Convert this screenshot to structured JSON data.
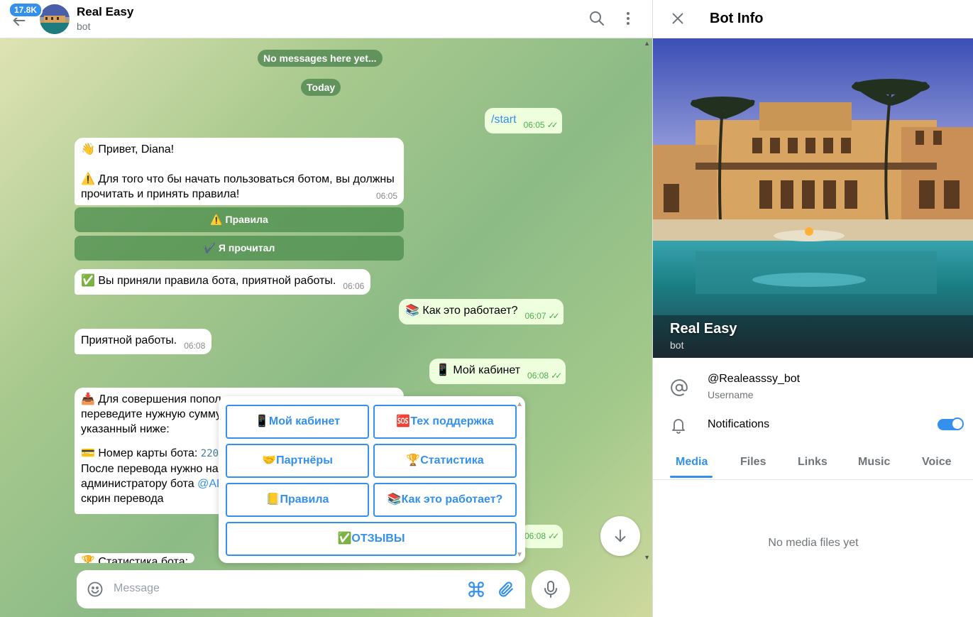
{
  "chat_header": {
    "unread_badge": "17.8K",
    "title": "Real Easy",
    "subtitle": "bot"
  },
  "service": {
    "empty": "No messages here yet...",
    "date": "Today"
  },
  "messages": [
    {
      "dir": "out",
      "text": "/start",
      "time": "06:05"
    },
    {
      "dir": "in",
      "line1": "👋 Привет, Diana!",
      "line2": "⚠️ Для того что бы начать пользоваться ботом, вы должны прочитать и принять правила!",
      "time": "06:05"
    },
    {
      "dir": "in",
      "text": "✅ Вы приняли правила бота, приятной работы.",
      "time": "06:06"
    },
    {
      "dir": "out",
      "text": "📚 Как это работает?",
      "time": "06:07"
    },
    {
      "dir": "in",
      "text": "Приятной работы.",
      "time": "06:08"
    },
    {
      "dir": "out",
      "text": "📱 Мой кабинет",
      "time": "06:08"
    },
    {
      "dir": "in",
      "line1": "📥 Для совершения попол",
      "line2": "переведите нужную сумму",
      "line3": "указанный ниже:",
      "line4": "💳 Номер карты бота: ",
      "card": "220",
      "line5": "После перевода нужно на",
      "line6": "администратору бота ",
      "admin": "@AD",
      "line7": "скрин перевода"
    },
    {
      "dir": "out",
      "text": "",
      "time": "06:08"
    },
    {
      "dir": "in",
      "text": "🏆 Статистика бота:"
    }
  ],
  "inline_buttons": {
    "rules": "⚠️ Правила",
    "read": "✔️ Я прочитал"
  },
  "keyboard": {
    "buttons": [
      "📱Мой кабинет",
      "🆘Тех поддержка",
      "🤝Партнёры",
      "🏆Статистика",
      "📒Правила",
      "📚Как это работает?",
      "✅ОТЗЫВЫ"
    ]
  },
  "composer": {
    "placeholder": "Message"
  },
  "info": {
    "title": "Bot Info",
    "name": "Real Easy",
    "subtitle": "bot",
    "username": "@Realeasssy_bot",
    "username_label": "Username",
    "notifications_label": "Notifications",
    "notifications_on": true,
    "tabs": [
      "Media",
      "Files",
      "Links",
      "Music",
      "Voice"
    ],
    "active_tab": "Media",
    "empty_media": "No media files yet"
  },
  "icons": {
    "back": "arrow-left-icon",
    "search": "search-icon",
    "more": "more-vertical-icon",
    "close": "close-icon",
    "at": "at-sign-icon",
    "bell": "bell-icon",
    "emoji": "emoji-icon",
    "command": "command-icon",
    "attach": "paperclip-icon",
    "mic": "microphone-icon",
    "scroll": "arrow-down-icon"
  },
  "colors": {
    "accent": "#3390ec",
    "outgoing_bubble": "#eeffde",
    "check_green": "#4fae4e",
    "service_green": "#4a824c"
  }
}
